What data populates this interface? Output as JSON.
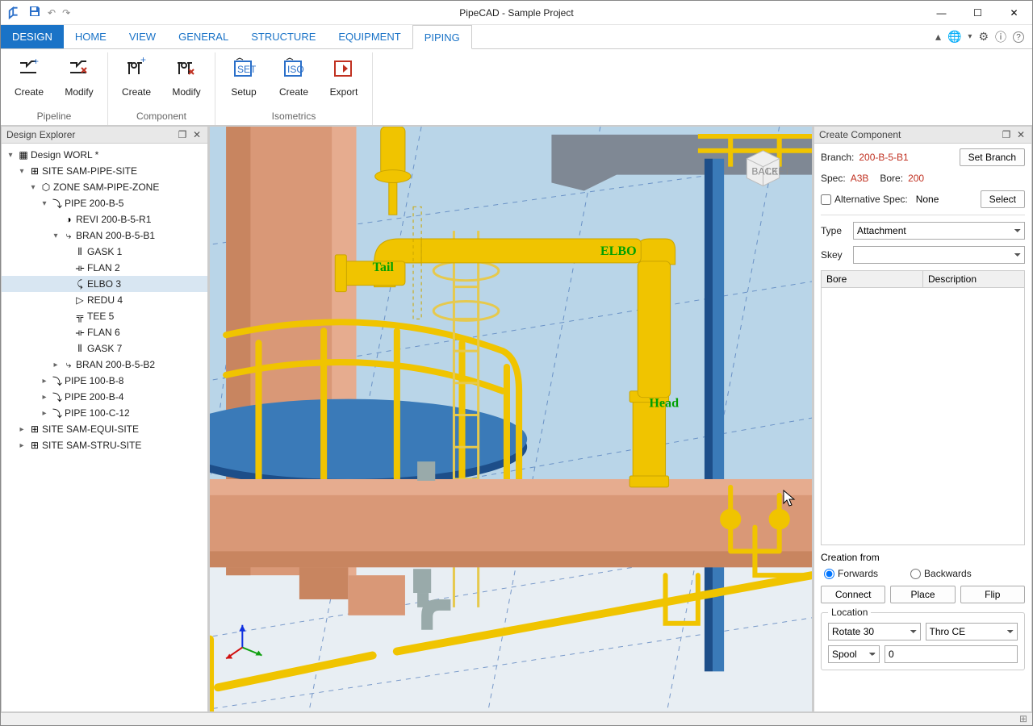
{
  "app_title": "PipeCAD - Sample Project",
  "menu_tabs": [
    "DESIGN",
    "HOME",
    "VIEW",
    "GENERAL",
    "STRUCTURE",
    "EQUIPMENT",
    "PIPING"
  ],
  "active_menu_tab": "PIPING",
  "ribbon": {
    "groups": [
      {
        "title": "Pipeline",
        "items": [
          {
            "label": "Create",
            "icon": "pipe-create"
          },
          {
            "label": "Modify",
            "icon": "pipe-modify"
          }
        ]
      },
      {
        "title": "Component",
        "items": [
          {
            "label": "Create",
            "icon": "comp-create"
          },
          {
            "label": "Modify",
            "icon": "comp-modify"
          }
        ]
      },
      {
        "title": "Isometrics",
        "items": [
          {
            "label": "Setup",
            "icon": "iso-setup"
          },
          {
            "label": "Create",
            "icon": "iso-create"
          },
          {
            "label": "Export",
            "icon": "iso-export"
          }
        ]
      }
    ]
  },
  "left_panel": {
    "title": "Design Explorer",
    "tree_root": "Design WORL *",
    "nodes": {
      "site_pipe": "SITE SAM-PIPE-SITE",
      "zone": "ZONE SAM-PIPE-ZONE",
      "pipe1": "PIPE 200-B-5",
      "revi": "REVI 200-B-5-R1",
      "bran1": "BRAN 200-B-5-B1",
      "gask1": "GASK 1",
      "flan2": "FLAN 2",
      "elbo3": "ELBO 3",
      "redu4": "REDU 4",
      "tee5": "TEE 5",
      "flan6": "FLAN 6",
      "gask7": "GASK 7",
      "bran2": "BRAN 200-B-5-B2",
      "pipe2": "PIPE 100-B-8",
      "pipe3": "PIPE 200-B-4",
      "pipe4": "PIPE 100-C-12",
      "site_equi": "SITE SAM-EQUI-SITE",
      "site_stru": "SITE SAM-STRU-SITE"
    }
  },
  "viewport_labels": {
    "tail": "Tail",
    "head": "Head",
    "elbo": "ELBO"
  },
  "right_panel": {
    "title": "Create Component",
    "branch_label": "Branch:",
    "branch_value": "200-B-5-B1",
    "set_branch_btn": "Set Branch",
    "spec_label": "Spec:",
    "spec_value": "A3B",
    "bore_label": "Bore:",
    "bore_value": "200",
    "alt_spec_label": "Alternative Spec:",
    "alt_spec_value": "None",
    "select_btn": "Select",
    "type_label": "Type",
    "type_value": "Attachment",
    "skey_label": "Skey",
    "list_cols": [
      "Bore",
      "Description"
    ],
    "creation_from_label": "Creation from",
    "forward_label": "Forwards",
    "backward_label": "Backwards",
    "btn_connect": "Connect",
    "btn_place": "Place",
    "btn_flip": "Flip",
    "location_title": "Location",
    "rotate_value": "Rotate 30",
    "thro_value": "Thro CE",
    "spool_value": "Spool",
    "spool_num": "0"
  }
}
